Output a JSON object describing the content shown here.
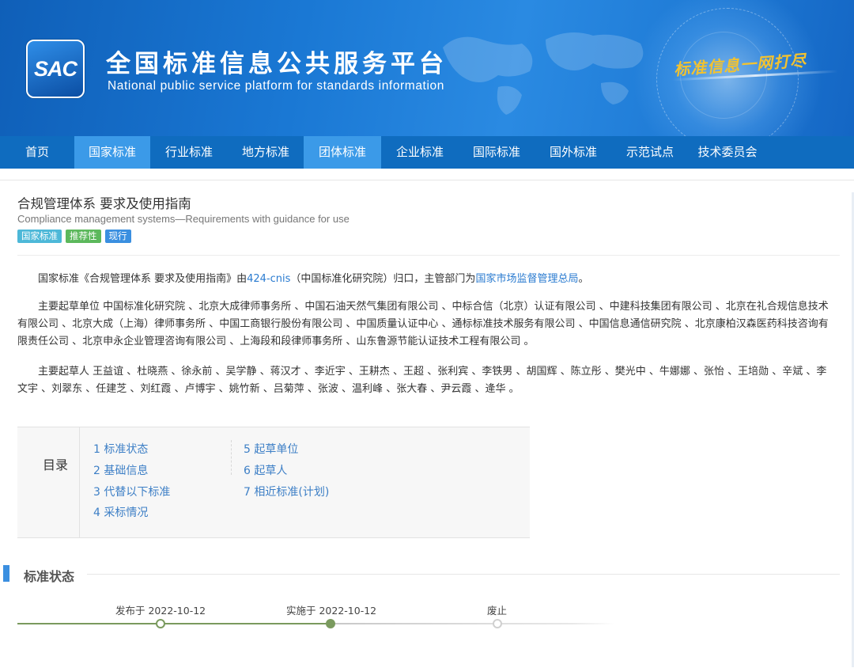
{
  "header": {
    "logo_text": "SAC",
    "title": "全国标准信息公共服务平台",
    "subtitle": "National public service platform  for standards information",
    "slogan": "标准信息一网打尽"
  },
  "nav": {
    "items": [
      {
        "label": "首页",
        "active": false
      },
      {
        "label": "国家标准",
        "active": true
      },
      {
        "label": "行业标准",
        "active": false
      },
      {
        "label": "地方标准",
        "active": false
      },
      {
        "label": "团体标准",
        "active": true
      },
      {
        "label": "企业标准",
        "active": false
      },
      {
        "label": "国际标准",
        "active": false
      },
      {
        "label": "国外标准",
        "active": false
      },
      {
        "label": "示范试点",
        "active": false
      },
      {
        "label": "技术委员会",
        "active": false
      }
    ]
  },
  "standard": {
    "title": "合规管理体系 要求及使用指南",
    "title_en": "Compliance management systems—Requirements with guidance for use",
    "tags": [
      {
        "label": "国家标准",
        "color": "#4db8d8"
      },
      {
        "label": "推荐性",
        "color": "#5cb85c"
      },
      {
        "label": "现行",
        "color": "#3a8fe0"
      }
    ]
  },
  "intro": {
    "prefix": "国家标准《合规管理体系 要求及使用指南》由",
    "tc_link": "424-cnis",
    "middle": "（中国标准化研究院）归口，主管部门为",
    "dept_link": "国家市场监督管理总局",
    "suffix": "。"
  },
  "drafting_units": "主要起草单位 中国标准化研究院 、北京大成律师事务所 、中国石油天然气集团有限公司 、中标合信（北京）认证有限公司 、中建科技集团有限公司 、北京在礼合规信息技术有限公司 、北京大成（上海）律师事务所 、中国工商银行股份有限公司 、中国质量认证中心 、通标标准技术服务有限公司 、中国信息通信研究院 、北京康柏汉森医药科技咨询有限责任公司 、北京申永企业管理咨询有限公司 、上海段和段律师事务所 、山东鲁源节能认证技术工程有限公司 。",
  "drafters": "主要起草人 王益谊 、杜晓燕 、徐永前 、吴学静 、蒋汉才 、李近宇 、王耕杰 、王超 、张利宾 、李铁男 、胡国辉 、陈立彤 、樊光中 、牛娜娜 、张怡 、王培勋 、辛斌 、李文宇 、刘翠东 、任建芝 、刘红霞 、卢博宇 、姚竹新 、吕菊萍 、张波 、温利峰 、张大春 、尹云霞 、逄华 。",
  "toc": {
    "label": "目录",
    "items": [
      "1 标准状态",
      "2 基础信息",
      "3 代替以下标准",
      "4 采标情况",
      "5 起草单位",
      "6 起草人",
      "7 相近标准(计划)"
    ]
  },
  "status_section": {
    "title": "标准状态",
    "timeline": [
      {
        "label": "发布于 2022-10-12",
        "state": "done"
      },
      {
        "label": "实施于 2022-10-12",
        "state": "current"
      },
      {
        "label": "废止",
        "state": "pending"
      }
    ]
  },
  "colors": {
    "nav_bg": "#0f6cbf",
    "nav_active": "#3b9ae8",
    "link": "#2a7bd0",
    "timeline_done": "#7a9a5e"
  }
}
